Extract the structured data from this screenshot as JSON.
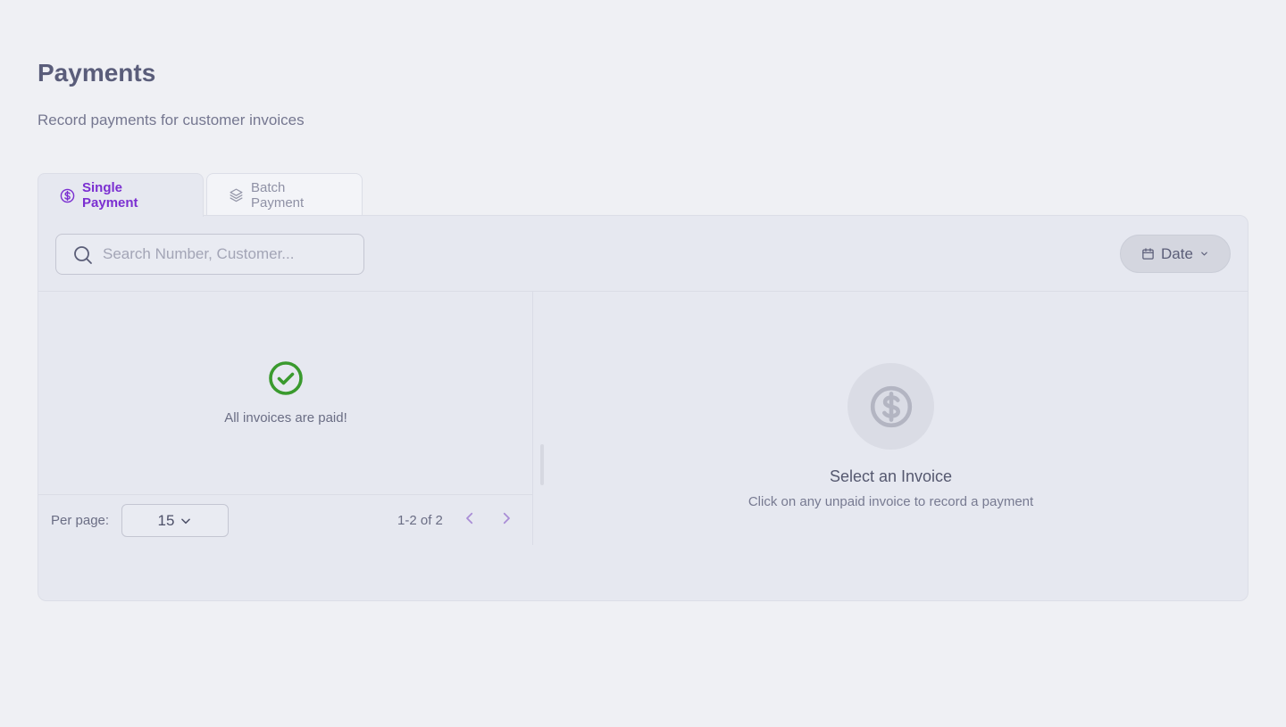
{
  "header": {
    "title": "Payments",
    "subtitle": "Record payments for customer invoices"
  },
  "tabs": [
    {
      "label": "Single Payment",
      "icon": "dollar-circle-icon",
      "active": true
    },
    {
      "label": "Batch Payment",
      "icon": "layers-icon",
      "active": false
    }
  ],
  "search": {
    "placeholder": "Search Number, Customer...",
    "value": ""
  },
  "date_filter": {
    "label": "Date",
    "icon": "calendar-icon"
  },
  "invoice_list": {
    "empty_message": "All invoices are paid!",
    "status_icon": "check-circle-icon",
    "per_page_label": "Per page:",
    "per_page_value": "15",
    "range": "1-2 of 2"
  },
  "detail": {
    "icon": "dollar-circle-icon",
    "heading": "Select an Invoice",
    "hint": "Click on any unpaid invoice to record a payment"
  },
  "colors": {
    "accent": "#7b2fd1",
    "success": "#3a9a2e",
    "background": "#eff0f4",
    "panel": "#e6e8f0"
  }
}
